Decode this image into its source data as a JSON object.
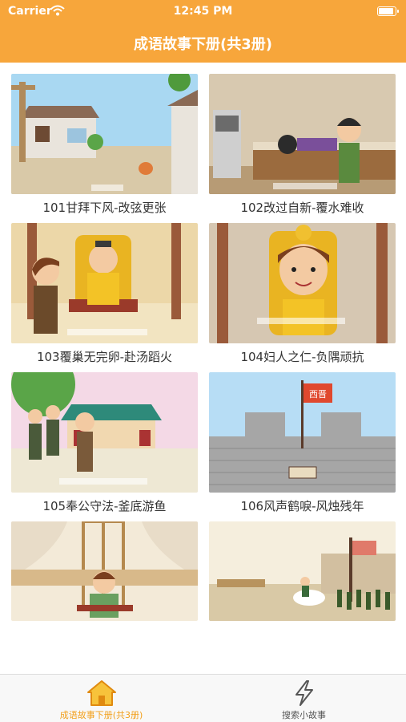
{
  "status_bar": {
    "carrier": "Carrier",
    "time": "12:45 PM"
  },
  "nav": {
    "title": "成语故事下册(共3册)"
  },
  "stories": [
    {
      "title": "101甘拜下风-改弦更张"
    },
    {
      "title": "102改过自新-覆水难收"
    },
    {
      "title": "103覆巢无完卵-赴汤蹈火"
    },
    {
      "title": "104妇人之仁-负隅顽抗"
    },
    {
      "title": "105奉公守法-釜底游鱼"
    },
    {
      "title": "106风声鹤唳-风烛残年"
    },
    {
      "title": ""
    },
    {
      "title": ""
    }
  ],
  "flag_text": "西晋",
  "tabbar": {
    "tabs": [
      {
        "label": "成语故事下册(共3册)",
        "icon": "home-icon",
        "active": true
      },
      {
        "label": "搜索小故事",
        "icon": "lightning-icon",
        "active": false
      }
    ]
  },
  "colors": {
    "accent": "#f7a63b",
    "active_tab": "#f2a01c"
  }
}
